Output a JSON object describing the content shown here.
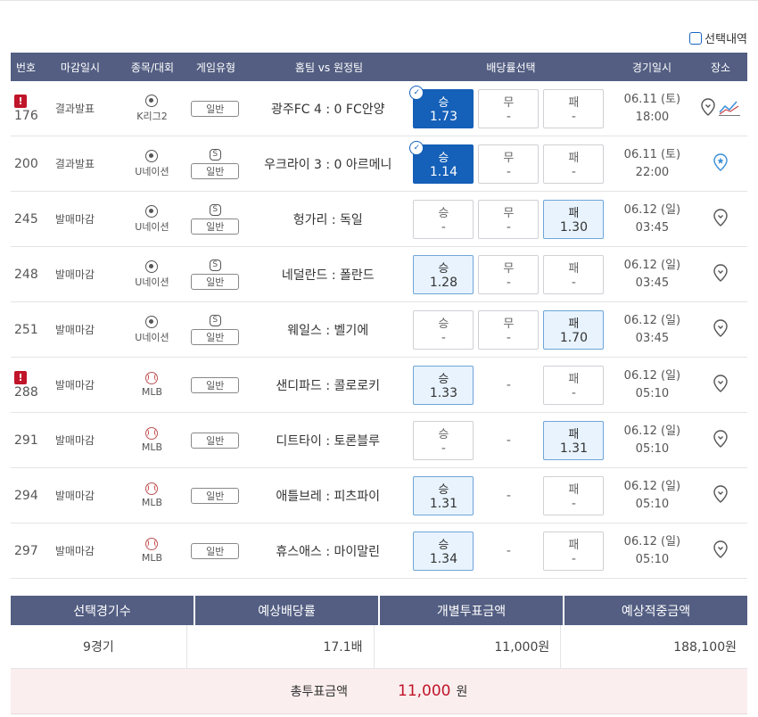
{
  "selection_history_label": "선택내역",
  "headers": [
    "번호",
    "마감일시",
    "종목/대회",
    "게임유형",
    "홈팀 vs 원정팀",
    "배당률선택",
    "경기일시",
    "장소"
  ],
  "rows": [
    {
      "num": "176",
      "alert": true,
      "deadline": "결과발표",
      "sport_icon": "soccer-ball-icon",
      "league": "K리그2",
      "special": false,
      "type": "일반",
      "match": "광주FC 4 : 0 FC안양",
      "odds": [
        {
          "label": "승",
          "value": "1.73",
          "state": "selected"
        },
        {
          "label": "무",
          "value": "-",
          "state": "normal"
        },
        {
          "label": "패",
          "value": "-",
          "state": "normal"
        }
      ],
      "date": "06.11 (토)",
      "time": "18:00",
      "venue_icons": [
        "location-pin-icon",
        "trend-chart-icon"
      ]
    },
    {
      "num": "200",
      "alert": false,
      "deadline": "결과발표",
      "sport_icon": "soccer-ball-icon",
      "league": "U네이션",
      "special": true,
      "special_label": "S",
      "type": "일반",
      "match": "우크라이 3 : 0 아르메니",
      "odds": [
        {
          "label": "승",
          "value": "1.14",
          "state": "selected"
        },
        {
          "label": "무",
          "value": "-",
          "state": "normal"
        },
        {
          "label": "패",
          "value": "-",
          "state": "normal"
        }
      ],
      "date": "06.11 (토)",
      "time": "22:00",
      "venue_icons": [
        "location-pin-filled-icon"
      ]
    },
    {
      "num": "245",
      "alert": false,
      "deadline": "발매마감",
      "sport_icon": "soccer-ball-icon",
      "league": "U네이션",
      "special": true,
      "special_label": "S",
      "type": "일반",
      "match": "헝가리 : 독일",
      "odds": [
        {
          "label": "승",
          "value": "-",
          "state": "normal"
        },
        {
          "label": "무",
          "value": "-",
          "state": "normal"
        },
        {
          "label": "패",
          "value": "1.30",
          "state": "highlighted"
        }
      ],
      "date": "06.12 (일)",
      "time": "03:45",
      "venue_icons": [
        "location-pin-icon"
      ]
    },
    {
      "num": "248",
      "alert": false,
      "deadline": "발매마감",
      "sport_icon": "soccer-ball-icon",
      "league": "U네이션",
      "special": true,
      "special_label": "S",
      "type": "일반",
      "match": "네덜란드 : 폴란드",
      "odds": [
        {
          "label": "승",
          "value": "1.28",
          "state": "highlighted"
        },
        {
          "label": "무",
          "value": "-",
          "state": "normal"
        },
        {
          "label": "패",
          "value": "-",
          "state": "normal"
        }
      ],
      "date": "06.12 (일)",
      "time": "03:45",
      "venue_icons": [
        "location-pin-icon"
      ]
    },
    {
      "num": "251",
      "alert": false,
      "deadline": "발매마감",
      "sport_icon": "soccer-ball-icon",
      "league": "U네이션",
      "special": true,
      "special_label": "S",
      "type": "일반",
      "match": "웨일스 : 벨기에",
      "odds": [
        {
          "label": "승",
          "value": "-",
          "state": "normal"
        },
        {
          "label": "무",
          "value": "-",
          "state": "normal"
        },
        {
          "label": "패",
          "value": "1.70",
          "state": "highlighted"
        }
      ],
      "date": "06.12 (일)",
      "time": "03:45",
      "venue_icons": [
        "location-pin-icon"
      ]
    },
    {
      "num": "288",
      "alert": true,
      "deadline": "발매마감",
      "sport_icon": "baseball-icon",
      "league": "MLB",
      "special": false,
      "type": "일반",
      "match": "샌디파드 : 콜로로키",
      "odds": [
        {
          "label": "승",
          "value": "1.33",
          "state": "highlighted"
        },
        {
          "label": "",
          "value": "-",
          "state": "none"
        },
        {
          "label": "패",
          "value": "-",
          "state": "normal"
        }
      ],
      "date": "06.12 (일)",
      "time": "05:10",
      "venue_icons": [
        "location-pin-icon"
      ]
    },
    {
      "num": "291",
      "alert": false,
      "deadline": "발매마감",
      "sport_icon": "baseball-icon",
      "league": "MLB",
      "special": false,
      "type": "일반",
      "match": "디트타이 : 토론블루",
      "odds": [
        {
          "label": "승",
          "value": "-",
          "state": "normal"
        },
        {
          "label": "",
          "value": "-",
          "state": "none"
        },
        {
          "label": "패",
          "value": "1.31",
          "state": "highlighted"
        }
      ],
      "date": "06.12 (일)",
      "time": "05:10",
      "venue_icons": [
        "location-pin-icon"
      ]
    },
    {
      "num": "294",
      "alert": false,
      "deadline": "발매마감",
      "sport_icon": "baseball-icon",
      "league": "MLB",
      "special": false,
      "type": "일반",
      "match": "애틀브레 : 피츠파이",
      "odds": [
        {
          "label": "승",
          "value": "1.31",
          "state": "highlighted"
        },
        {
          "label": "",
          "value": "-",
          "state": "none"
        },
        {
          "label": "패",
          "value": "-",
          "state": "normal"
        }
      ],
      "date": "06.12 (일)",
      "time": "05:10",
      "venue_icons": [
        "location-pin-icon"
      ]
    },
    {
      "num": "297",
      "alert": false,
      "deadline": "발매마감",
      "sport_icon": "baseball-icon",
      "league": "MLB",
      "special": false,
      "type": "일반",
      "match": "휴스애스 : 마이말린",
      "odds": [
        {
          "label": "승",
          "value": "1.34",
          "state": "highlighted"
        },
        {
          "label": "",
          "value": "-",
          "state": "none"
        },
        {
          "label": "패",
          "value": "-",
          "state": "normal"
        }
      ],
      "date": "06.12 (일)",
      "time": "05:10",
      "venue_icons": [
        "location-pin-icon"
      ]
    }
  ],
  "summary": {
    "headers": [
      "선택경기수",
      "예상배당률",
      "개별투표금액",
      "예상적중금액"
    ],
    "values": [
      "9경기",
      "17.1배",
      "11,000원",
      "188,100원"
    ],
    "total_label": "총투표금액",
    "total_amount": "11,000",
    "total_unit": "원"
  },
  "colors": {
    "header_bg": "#535e82",
    "selected": "#1560b8",
    "highlight": "#e8f3fd",
    "alert": "#c0152a"
  }
}
